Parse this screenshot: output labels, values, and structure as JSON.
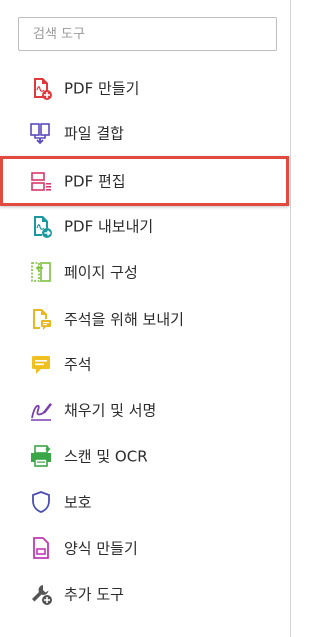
{
  "search": {
    "placeholder": "검색 도구"
  },
  "tools": [
    {
      "label": "PDF 만들기",
      "icon": "create-pdf-icon"
    },
    {
      "label": "파일 결합",
      "icon": "combine-files-icon"
    },
    {
      "label": "PDF 편집",
      "icon": "edit-pdf-icon",
      "highlighted": true
    },
    {
      "label": "PDF 내보내기",
      "icon": "export-pdf-icon"
    },
    {
      "label": "페이지 구성",
      "icon": "organize-pages-icon"
    },
    {
      "label": "주석을 위해 보내기",
      "icon": "send-for-comments-icon"
    },
    {
      "label": "주석",
      "icon": "comment-icon"
    },
    {
      "label": "채우기 및 서명",
      "icon": "fill-sign-icon"
    },
    {
      "label": "스캔 및 OCR",
      "icon": "scan-ocr-icon"
    },
    {
      "label": "보호",
      "icon": "protect-icon"
    },
    {
      "label": "양식 만들기",
      "icon": "prepare-form-icon"
    },
    {
      "label": "추가 도구",
      "icon": "more-tools-icon"
    }
  ],
  "colors": {
    "highlight_border": "#e24a3f",
    "create_pdf": "#e0393e",
    "combine": "#5b4bbf",
    "edit_pdf": "#d9386a",
    "export_pdf": "#1a9aa0",
    "organize": "#7fbf3f",
    "send_comments": "#e8b820",
    "comment": "#f0c020",
    "fill_sign": "#7a3fb0",
    "scan": "#3aa648",
    "protect": "#4a4fb0",
    "form": "#c13ab7",
    "more": "#555555"
  }
}
